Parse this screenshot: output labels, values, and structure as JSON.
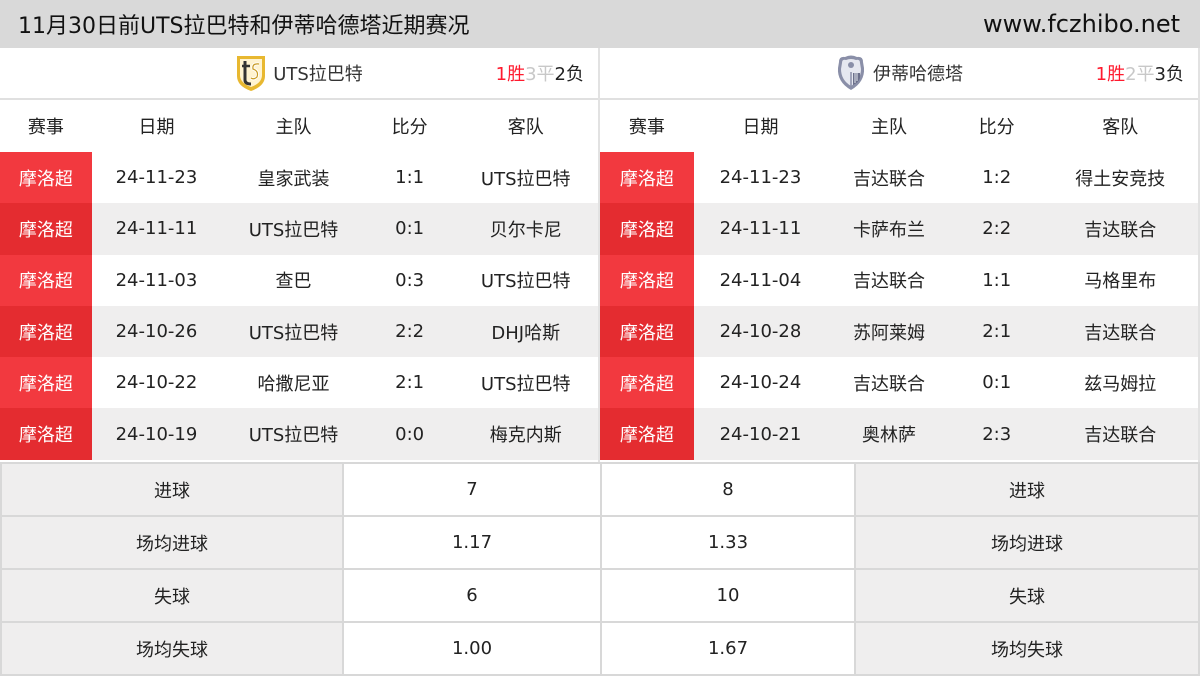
{
  "header": {
    "title": "11月30日前UTS拉巴特和伊蒂哈德塔近期赛况",
    "site": "www.fczhibo.net"
  },
  "columns": [
    "赛事",
    "日期",
    "主队",
    "比分",
    "客队"
  ],
  "left_team": {
    "name": "UTS拉巴特",
    "logo_icon": "uts-rabat-crest-icon",
    "record": {
      "wins": "1胜",
      "draws": "3平",
      "losses": "2负"
    },
    "matches": [
      {
        "league": "摩洛超",
        "date": "24-11-23",
        "home": "皇家武装",
        "score": "1:1",
        "away": "UTS拉巴特"
      },
      {
        "league": "摩洛超",
        "date": "24-11-11",
        "home": "UTS拉巴特",
        "score": "0:1",
        "away": "贝尔卡尼"
      },
      {
        "league": "摩洛超",
        "date": "24-11-03",
        "home": "查巴",
        "score": "0:3",
        "away": "UTS拉巴特"
      },
      {
        "league": "摩洛超",
        "date": "24-10-26",
        "home": "UTS拉巴特",
        "score": "2:2",
        "away": "DHJ哈斯"
      },
      {
        "league": "摩洛超",
        "date": "24-10-22",
        "home": "哈撒尼亚",
        "score": "2:1",
        "away": "UTS拉巴特"
      },
      {
        "league": "摩洛超",
        "date": "24-10-19",
        "home": "UTS拉巴特",
        "score": "0:0",
        "away": "梅克内斯"
      }
    ]
  },
  "right_team": {
    "name": "伊蒂哈德塔",
    "logo_icon": "ittihad-tanger-crest-icon",
    "record": {
      "wins": "1胜",
      "draws": "2平",
      "losses": "3负"
    },
    "matches": [
      {
        "league": "摩洛超",
        "date": "24-11-23",
        "home": "吉达联合",
        "score": "1:2",
        "away": "得土安竞技"
      },
      {
        "league": "摩洛超",
        "date": "24-11-11",
        "home": "卡萨布兰",
        "score": "2:2",
        "away": "吉达联合"
      },
      {
        "league": "摩洛超",
        "date": "24-11-04",
        "home": "吉达联合",
        "score": "1:1",
        "away": "马格里布"
      },
      {
        "league": "摩洛超",
        "date": "24-10-28",
        "home": "苏阿莱姆",
        "score": "2:1",
        "away": "吉达联合"
      },
      {
        "league": "摩洛超",
        "date": "24-10-24",
        "home": "吉达联合",
        "score": "0:1",
        "away": "兹马姆拉"
      },
      {
        "league": "摩洛超",
        "date": "24-10-21",
        "home": "奥林萨",
        "score": "2:3",
        "away": "吉达联合"
      }
    ]
  },
  "stats": [
    {
      "label": "进球",
      "left": "7",
      "right": "8"
    },
    {
      "label": "场均进球",
      "left": "1.17",
      "right": "1.33"
    },
    {
      "label": "失球",
      "left": "6",
      "right": "10"
    },
    {
      "label": "场均失球",
      "left": "1.00",
      "right": "1.67"
    }
  ],
  "colors": {
    "league_badge": "#f2393f",
    "win": "#ff1a2e",
    "draw": "#c8c8c8",
    "header_bg": "#d9d9d9"
  }
}
